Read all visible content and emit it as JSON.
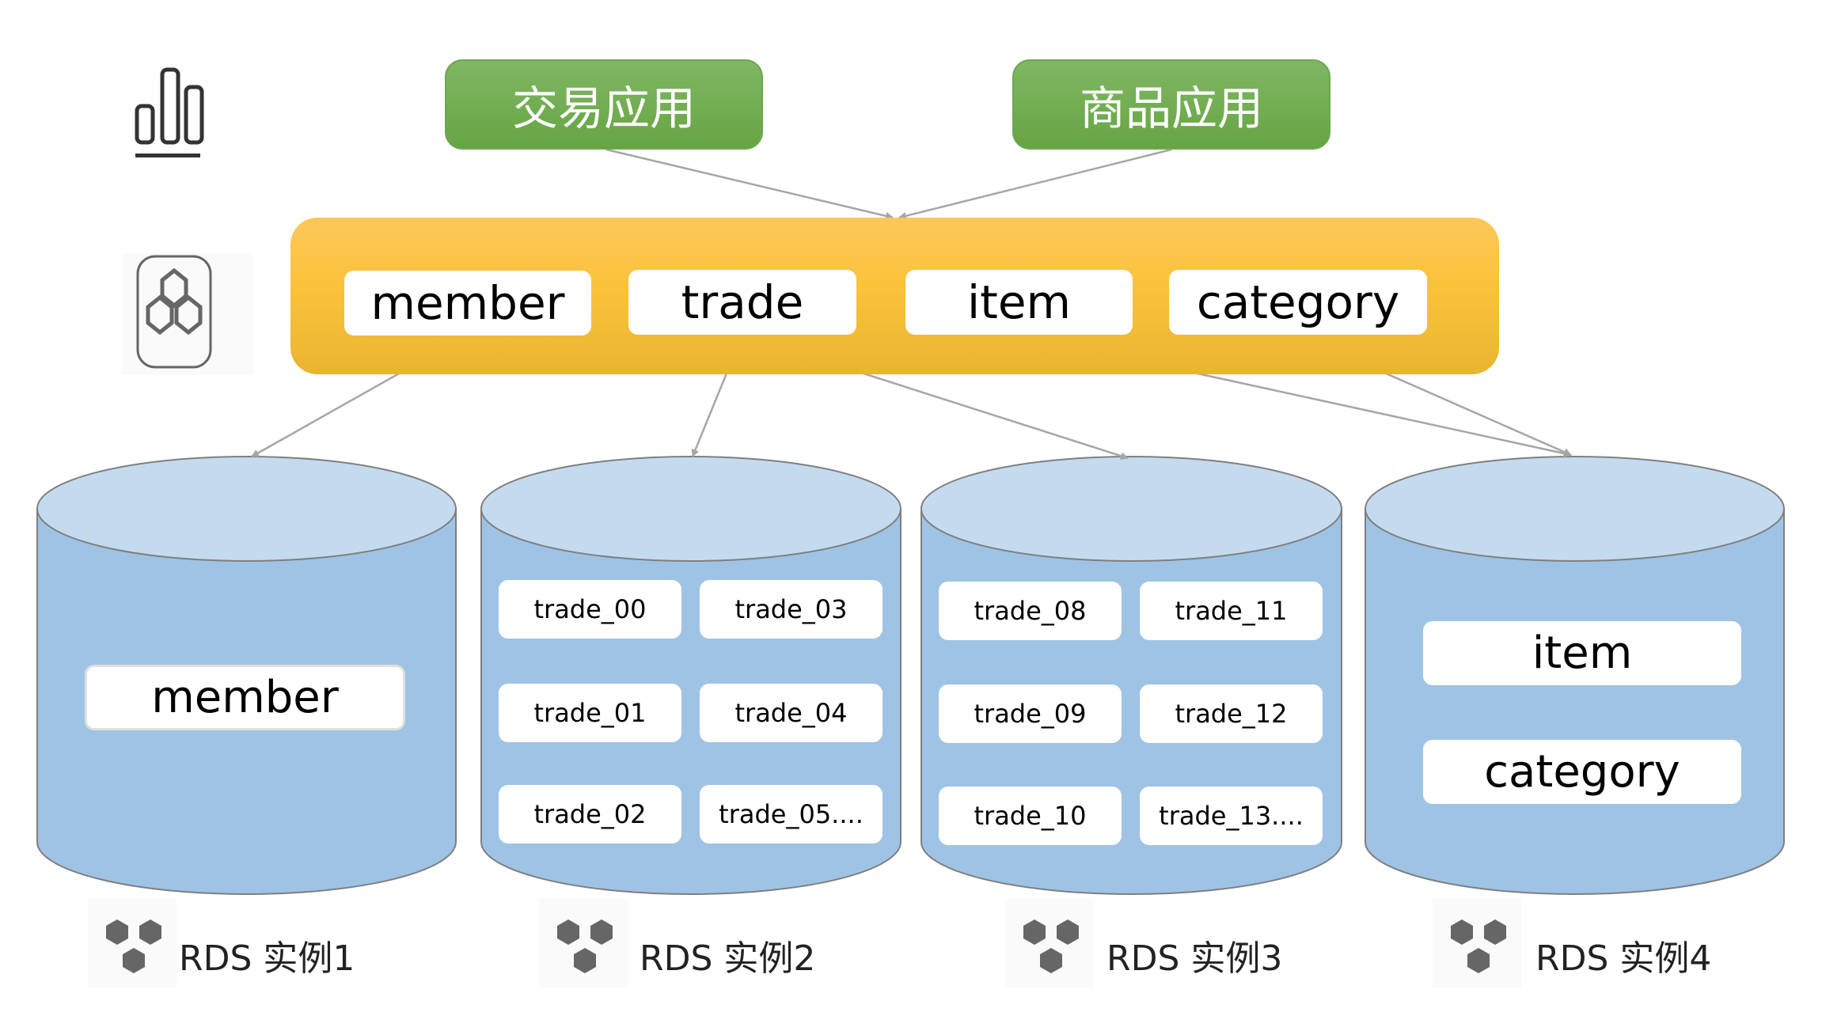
{
  "apps": [
    {
      "label": "交易应用"
    },
    {
      "label": "商品应用"
    }
  ],
  "middleware": {
    "icon": "hexagon-cluster-icon",
    "tables": [
      {
        "label": "member"
      },
      {
        "label": "trade"
      },
      {
        "label": "item"
      },
      {
        "label": "category"
      }
    ]
  },
  "side_icons": {
    "app_layer": "bar-chart-icon",
    "middleware_layer": "hexagon-cluster-icon"
  },
  "instances": [
    {
      "label": "RDS 实例1",
      "tables": [
        "member"
      ]
    },
    {
      "label": "RDS 实例2",
      "tables": [
        "trade_00",
        "trade_03",
        "trade_01",
        "trade_04",
        "trade_02",
        "trade_05...."
      ]
    },
    {
      "label": "RDS 实例3",
      "tables": [
        "trade_08",
        "trade_11",
        "trade_09",
        "trade_12",
        "trade_10",
        "trade_13...."
      ]
    },
    {
      "label": "RDS 实例4",
      "tables": [
        "item",
        "category"
      ]
    }
  ],
  "colors": {
    "app_green": "#6aa84f",
    "middleware_orange": "#fbc23a",
    "cylinder_body": "#9fc3e4",
    "cylinder_top": "#c4dbef",
    "arrow": "#a6a6a6",
    "rds_icon": "#666666"
  }
}
